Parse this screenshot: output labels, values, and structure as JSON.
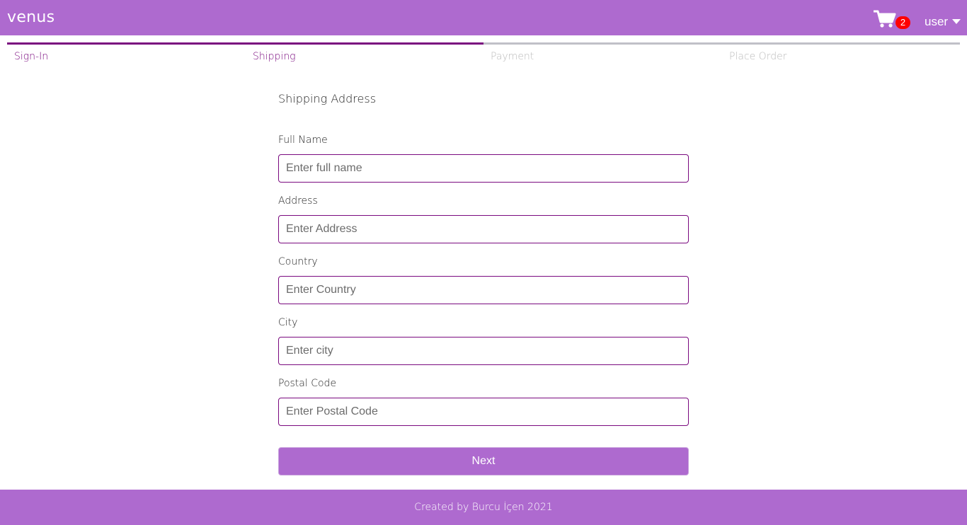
{
  "header": {
    "brand": "venus",
    "cart_count": "2",
    "cart_icon": "shopping-cart-icon",
    "user_label": "user",
    "user_caret_icon": "caret-down-icon"
  },
  "colors": {
    "primary": "#ae6acf",
    "accent": "#7a0a7f",
    "badge": "#ff0000",
    "step_inactive": "#c0c0c8"
  },
  "checkout_steps": [
    {
      "label": "Sign-In",
      "active": true
    },
    {
      "label": "Shipping",
      "active": true
    },
    {
      "label": "Payment",
      "active": false
    },
    {
      "label": "Place Order",
      "active": false
    }
  ],
  "form": {
    "title": "Shipping Address",
    "fields": [
      {
        "label": "Full Name",
        "placeholder": "Enter full name",
        "value": ""
      },
      {
        "label": "Address",
        "placeholder": "Enter Address",
        "value": ""
      },
      {
        "label": "Country",
        "placeholder": "Enter Country",
        "value": ""
      },
      {
        "label": "City",
        "placeholder": "Enter city",
        "value": ""
      },
      {
        "label": "Postal Code",
        "placeholder": "Enter Postal Code",
        "value": ""
      }
    ],
    "submit_label": "Next"
  },
  "footer": {
    "text": "Created by Burcu İçen 2021"
  }
}
